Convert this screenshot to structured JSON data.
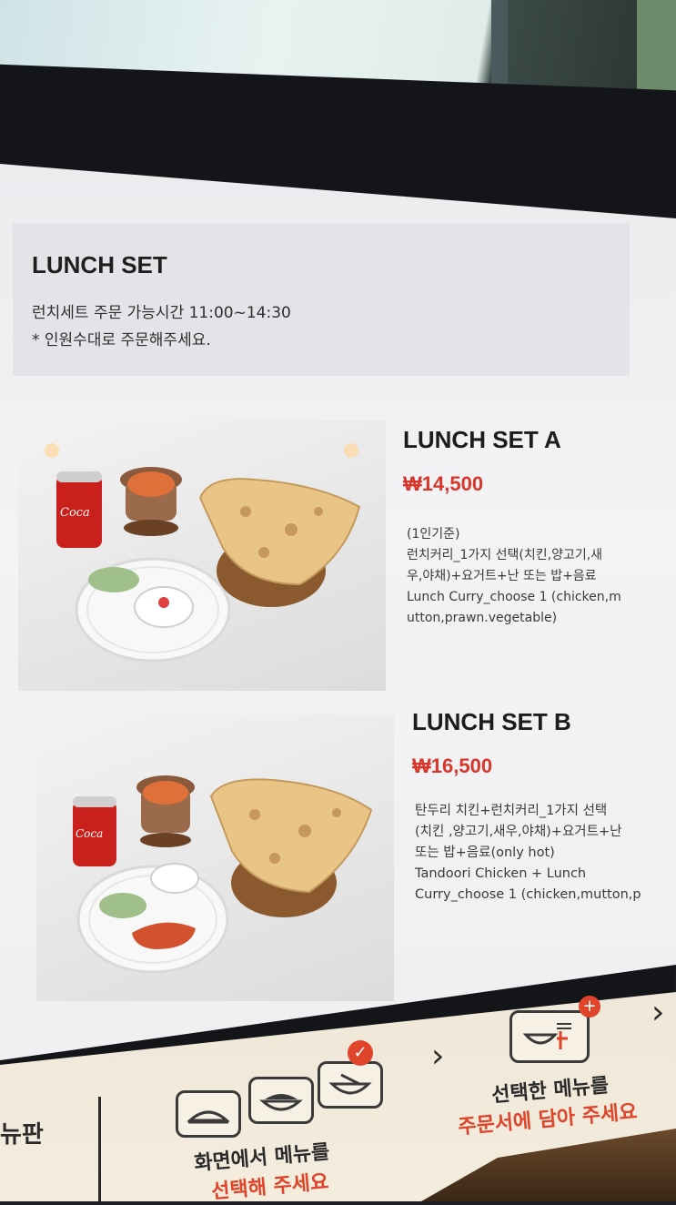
{
  "info": {
    "title": "LUNCH SET",
    "line1": "런치세트 주문 가능시간 11:00~14:30",
    "line2": "* 인원수대로 주문해주세요."
  },
  "set_a": {
    "name": "LUNCH SET A",
    "price": "₩14,500",
    "desc": [
      "(1인기준)",
      "런치커리_1가지 선택(치킨,양고기,새",
      "우,야채)+요거트+난 또는 밥+음료",
      " Lunch Curry_choose 1 (chicken,m",
      "utton,prawn.vegetable)"
    ]
  },
  "set_b": {
    "name": "LUNCH SET B",
    "price": "₩16,500",
    "desc": [
      "탄두리 치킨+런치커리_1가지 선택",
      "(치킨 ,양고기,새우,야채)+요거트+난",
      "또는 밥+음료(only hot)",
      "Tandoori Chicken + Lunch",
      "Curry_choose 1 (chicken,mutton,p"
    ]
  },
  "bottom": {
    "left_label": "뉴판",
    "step1_line1": "화면에서 메뉴를",
    "step1_line2": "선택해 주세요",
    "step2_line1": "선택한 메뉴를",
    "step2_line2": "주문서에 담아 주세요"
  }
}
